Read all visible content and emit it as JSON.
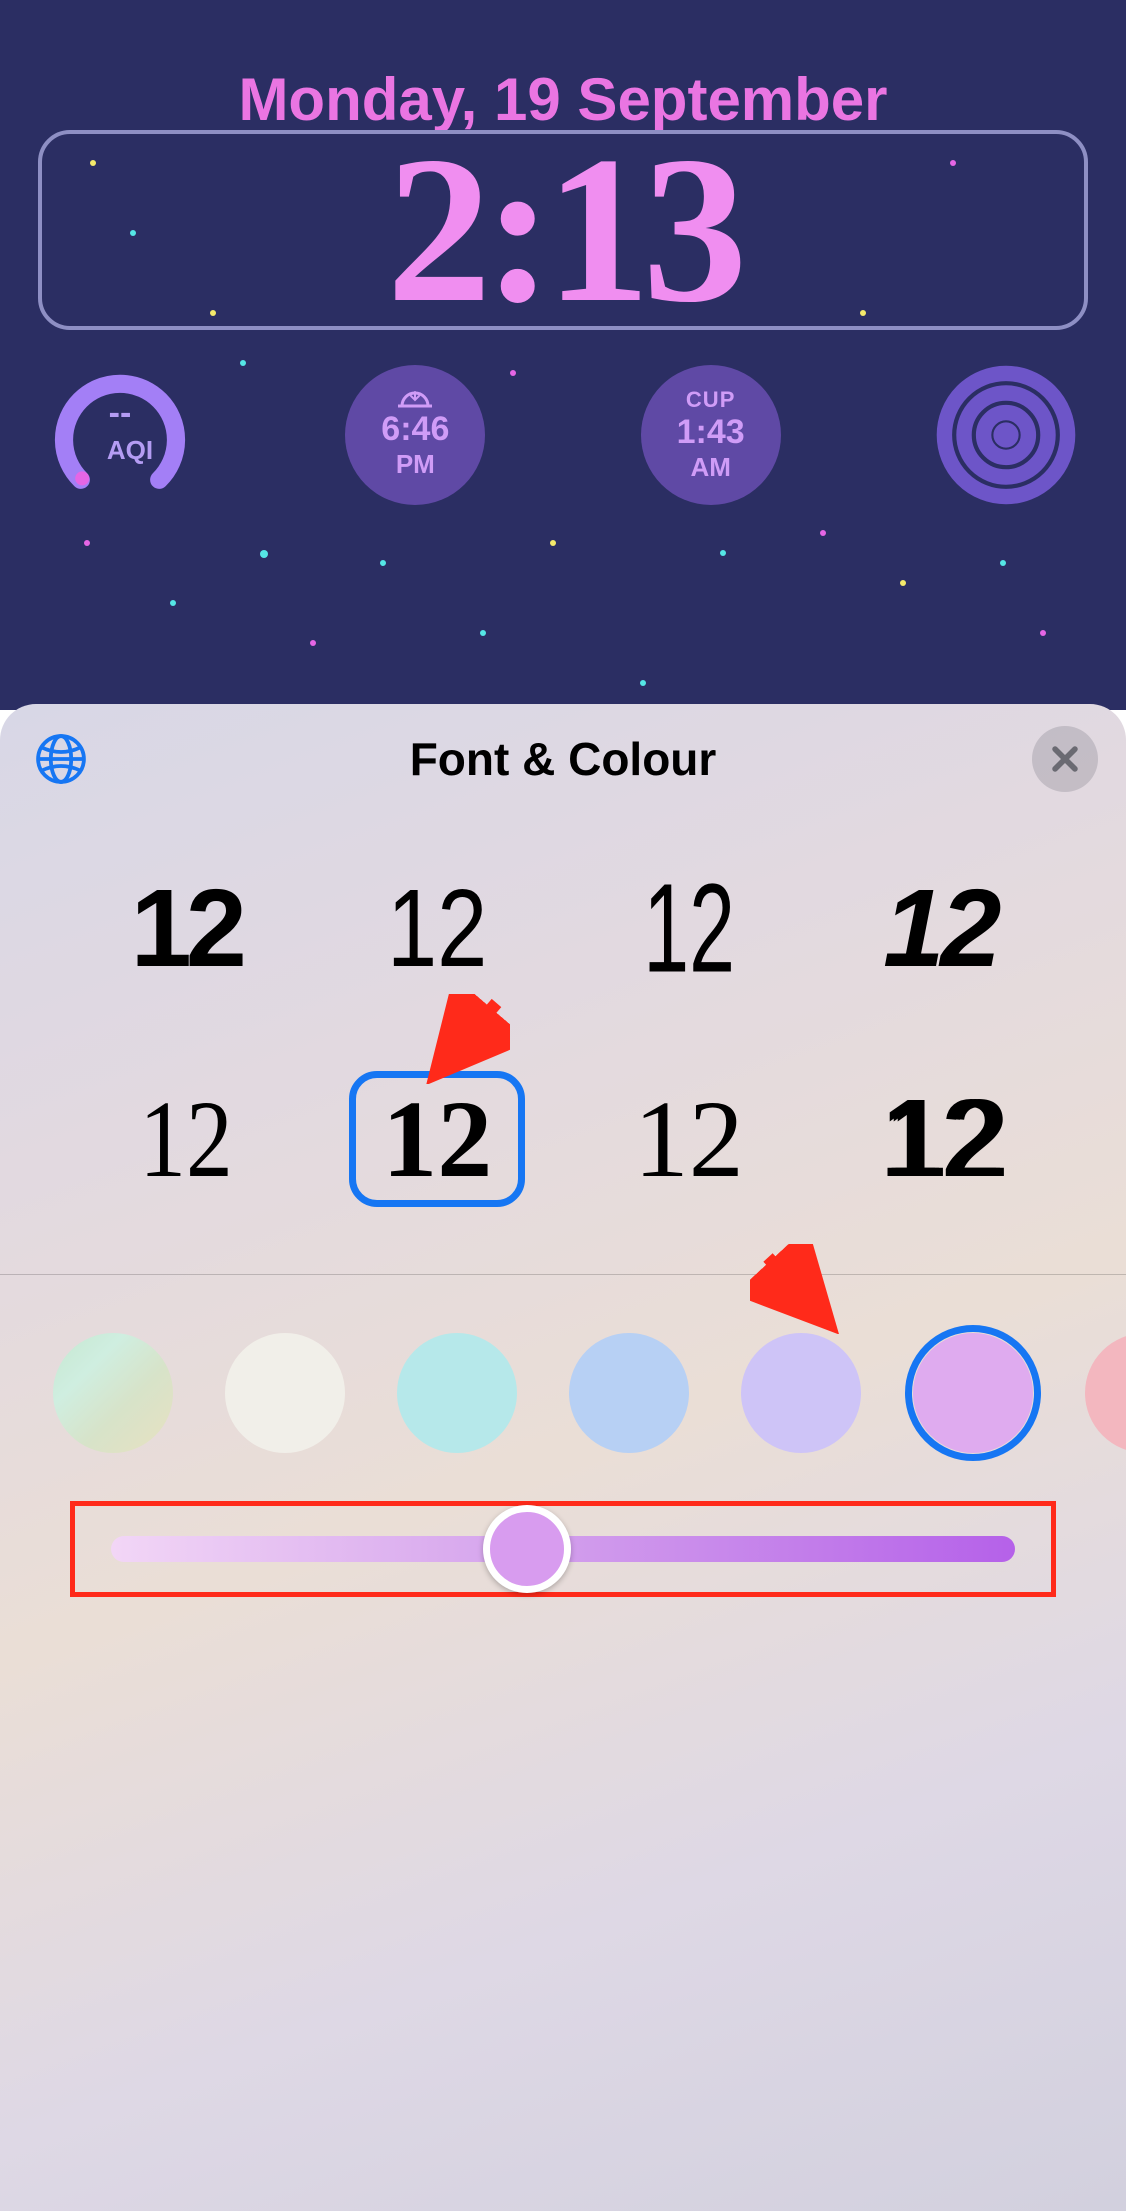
{
  "lockscreen": {
    "date": "Monday, 19 September",
    "time": "2:13",
    "accent_color": "#f08ef0",
    "widgets": {
      "aqi": {
        "value": "--",
        "label": "AQI"
      },
      "sunset": {
        "time": "6:46",
        "period": "PM"
      },
      "worldclock": {
        "city": "CUP",
        "time": "1:43",
        "period": "AM"
      }
    }
  },
  "panel": {
    "title": "Font & Colour",
    "font_sample_text": "12",
    "fonts": [
      {
        "id": "sf-rounded-bold",
        "selected": false
      },
      {
        "id": "sf-condensed",
        "selected": false
      },
      {
        "id": "sf-compressed",
        "selected": false
      },
      {
        "id": "sf-stencil",
        "selected": false
      },
      {
        "id": "newyork-light",
        "selected": false
      },
      {
        "id": "newyork-bold",
        "selected": true
      },
      {
        "id": "newyork-regular",
        "selected": false
      },
      {
        "id": "outline-triple",
        "selected": false
      }
    ],
    "colors": [
      {
        "id": "gradient",
        "css": "linear-gradient(135deg,#c6e7d0 0%, #cfeee0 30%, #d7e3c9 60%, #e8e1c1 100%)",
        "selected": false
      },
      {
        "id": "white",
        "css": "#f1efe9",
        "selected": false
      },
      {
        "id": "cyan",
        "css": "#b6e8ea",
        "selected": false
      },
      {
        "id": "blue",
        "css": "#b7d0f4",
        "selected": false
      },
      {
        "id": "lavender",
        "css": "#cec4f7",
        "selected": false
      },
      {
        "id": "violet",
        "css": "#dfabef",
        "selected": true
      },
      {
        "id": "pink",
        "css": "#f3b7bf",
        "selected": false
      }
    ],
    "slider": {
      "position_percent": 46,
      "track_gradient": "linear-gradient(to right,#f2d6f6 0%, #d3a0ec 48%, #b561e9 100%)",
      "highlight_color": "#ff2a1a"
    }
  },
  "annotations": {
    "arrow_color": "#ff2a1a",
    "arrow1_points_to": "selected-font",
    "arrow2_points_to": "selected-color"
  }
}
